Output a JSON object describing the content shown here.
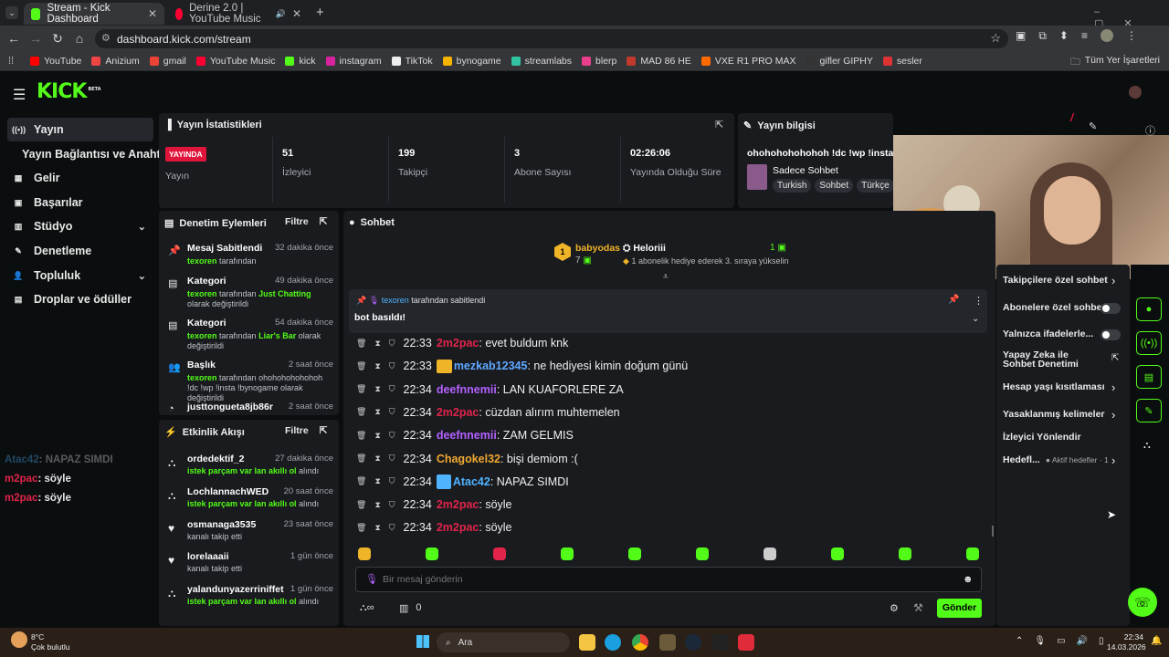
{
  "browser": {
    "tabs": [
      {
        "title": "Stream - Kick Dashboard",
        "favicon_color": "#53fc18"
      },
      {
        "title": "Derine 2.0 | YouTube Music",
        "favicon_color": "#ff0033"
      }
    ],
    "url": "dashboard.kick.com/stream",
    "bookmarks": [
      {
        "label": "YouTube",
        "color": "#ff0000"
      },
      {
        "label": "Anizium",
        "color": "#e44"
      },
      {
        "label": "gmail",
        "color": "#ea4335"
      },
      {
        "label": "YouTube Music",
        "color": "#ff0033"
      },
      {
        "label": "kick",
        "color": "#53fc18"
      },
      {
        "label": "instagram",
        "color": "#d6249f"
      },
      {
        "label": "TikTok",
        "color": "#eee"
      },
      {
        "label": "bynogame",
        "color": "#f4b400"
      },
      {
        "label": "streamlabs",
        "color": "#31c3a2"
      },
      {
        "label": "blerp",
        "color": "#e83e8c"
      },
      {
        "label": "MAD 86 HE",
        "color": "#c0392b"
      },
      {
        "label": "VXE R1 PRO MAX",
        "color": "#ff6a00"
      },
      {
        "label": "gifler GIPHY",
        "color": "#333"
      },
      {
        "label": "sesler",
        "color": "#d33"
      }
    ],
    "all_bookmarks": "Tüm Yer İşaretleri"
  },
  "kick": {
    "logo": "KICK",
    "logo_badge": "BETA",
    "sidebar": [
      {
        "label": "Yayın",
        "icon": "broadcast-icon",
        "glyph": "((•))",
        "active": true
      },
      {
        "label": "Yayın Bağlantısı ve Anahtarı",
        "icon": "",
        "glyph": ""
      },
      {
        "label": "Gelir",
        "icon": "revenue-icon",
        "glyph": "▦"
      },
      {
        "label": "Başarılar",
        "icon": "achievements-icon",
        "glyph": "▣"
      },
      {
        "label": "Stüdyo",
        "icon": "studio-icon",
        "glyph": "▥",
        "chevron": true
      },
      {
        "label": "Denetleme",
        "icon": "wrench-icon",
        "glyph": "✎"
      },
      {
        "label": "Topluluk",
        "icon": "community-icon",
        "glyph": "👤",
        "chevron": true
      },
      {
        "label": "Droplar ve ödüller",
        "icon": "drops-icon",
        "glyph": "▤"
      }
    ],
    "overlay_chat": [
      {
        "user": "Atac42",
        "text": ": NAPAZ SIMDI",
        "faded": true
      },
      {
        "user": "m2pac",
        "text": ": söyle"
      },
      {
        "user": "m2pac",
        "text": ": söyle"
      }
    ],
    "stats": {
      "title": "Yayın İstatistikleri",
      "live_badge": "YAYINDA",
      "live_label": "Yayın",
      "items": [
        {
          "value": "51",
          "label": "İzleyici"
        },
        {
          "value": "199",
          "label": "Takipçi"
        },
        {
          "value": "3",
          "label": "Abone Sayısı"
        },
        {
          "value": "02:26:06",
          "label": "Yayında Olduğu Süre"
        }
      ]
    },
    "stream_info": {
      "title": "Yayın bilgisi",
      "stream_title": "ohohohohohohoh !dc !wp !insta !by",
      "category": "Sadece Sohbet",
      "tags": [
        "Turkish",
        "Sohbet",
        "Türkçe"
      ]
    },
    "mod_actions": {
      "title": "Denetim Eylemleri",
      "filter": "Filtre",
      "items": [
        {
          "title": "Mesaj Sabitlendi",
          "time": "32 dakika önce",
          "user": "texoren",
          "sub": "tarafından",
          "icon": "pin-icon",
          "glyph": "📌"
        },
        {
          "title": "Kategori",
          "time": "49 dakika önce",
          "user": "texoren",
          "sub": "tarafından",
          "hl": "Just Chatting",
          "sub2": "olarak değiştirildi",
          "icon": "category-icon",
          "glyph": "▤"
        },
        {
          "title": "Kategori",
          "time": "54 dakika önce",
          "user": "texoren",
          "sub": "tarafından",
          "hl": "Liar's Bar",
          "sub2": "olarak değiştirildi",
          "icon": "category-icon",
          "glyph": "▤"
        },
        {
          "title": "Başlık",
          "time": "2 saat önce",
          "user": "texoren",
          "sub": "tarafından",
          "hl": "",
          "sub2": "ohohohohohohoh !dc !wp !insta !bynogame olarak değiştirildi",
          "icon": "title-icon",
          "glyph": "👥"
        },
        {
          "title": "justtongueta8jb86r",
          "time": "2 saat önce",
          "icon": "gauge-icon",
          "glyph": "◔"
        }
      ]
    },
    "activity": {
      "title": "Etkinlik Akışı",
      "filter": "Filtre",
      "items": [
        {
          "user": "ordedektif_2",
          "time": "27 dakika önce",
          "hl": "istek parçam var lan akıllı ol",
          "sub": "alındı",
          "icon": "redeem-icon"
        },
        {
          "user": "LochlannachWED",
          "time": "20 saat önce",
          "hl": "istek parçam var lan akıllı ol",
          "sub": "alındı",
          "icon": "redeem-icon"
        },
        {
          "user": "osmanaga3535",
          "time": "23 saat önce",
          "hl": "",
          "sub": "kanalı takip etti",
          "icon": "heart-icon"
        },
        {
          "user": "lorelaaaii",
          "time": "1 gün önce",
          "hl": "",
          "sub": "kanalı takip etti",
          "icon": "heart-icon"
        },
        {
          "user": "yalandunyazerriniffet",
          "time": "1 gün önce",
          "hl": "istek parçam var lan akıllı ol",
          "sub": "alındı",
          "icon": "redeem-icon"
        }
      ]
    },
    "chat": {
      "title": "Sohbet",
      "gift_user": "babyodas",
      "gift_count": "7",
      "gift_target": "Heloriii",
      "gift_rank": "1",
      "gift_text": "1 abonelik hediye ederek 3. sıraya yükselin",
      "pinned_by": "texoren",
      "pinned_suffix": "tarafından sabitlendi",
      "pinned_text": "bot basıldı!",
      "messages": [
        {
          "time": "22:33",
          "user": "2m2pac",
          "color": "#e0244a",
          "text": ": evet buldum knk",
          "badge": ""
        },
        {
          "time": "22:33",
          "user": "mezkab12345",
          "color": "#5fa8ff",
          "text": ": ne hediyesi kimin doğum günü",
          "badge": "crown"
        },
        {
          "time": "22:34",
          "user": "deefnnemii",
          "color": "#b461ff",
          "text": ": LAN KUAFORLERE ZA",
          "badge": ""
        },
        {
          "time": "22:34",
          "user": "2m2pac",
          "color": "#e0244a",
          "text": ": cüzdan alırım muhtemelen",
          "badge": ""
        },
        {
          "time": "22:34",
          "user": "deefnnemii",
          "color": "#b461ff",
          "text": ": ZAM GELMIS",
          "badge": ""
        },
        {
          "time": "22:34",
          "user": "Chagokel32",
          "color": "#f0a830",
          "text": ": bişi demiom :(",
          "badge": ""
        },
        {
          "time": "22:34",
          "user": "Atac42",
          "color": "#4fb3ff",
          "text": ": NAPAZ SIMDI",
          "badge": "avatar"
        },
        {
          "time": "22:34",
          "user": "2m2pac",
          "color": "#e0244a",
          "text": ": söyle",
          "badge": ""
        },
        {
          "time": "22:34",
          "user": "2m2pac",
          "color": "#e0244a",
          "text": ": söyle",
          "badge": ""
        }
      ],
      "input_placeholder": "Bir mesaj gönderin",
      "points": "0",
      "send": "Gönder"
    },
    "chat_settings": [
      {
        "label": "Takipçilere özel sohbet",
        "kind": "arrow"
      },
      {
        "label": "Abonelere özel sohbet",
        "kind": "toggle"
      },
      {
        "label": "Yalnızca ifadelerle...",
        "kind": "toggle"
      },
      {
        "label": "Yapay Zeka ile Sohbet Denetimi",
        "kind": "external"
      },
      {
        "label": "Hesap yaşı kısıtlaması",
        "kind": "arrow"
      },
      {
        "label": "Yasaklanmış kelimeler",
        "kind": "arrow"
      },
      {
        "label": "İzleyici Yönlendir",
        "kind": "none"
      },
      {
        "label": "Hedefl...",
        "kind": "arrow",
        "extra": "Aktif hedefler · 1"
      }
    ]
  },
  "taskbar": {
    "weather_temp": "8°C",
    "weather_text": "Çok bulutlu",
    "search": "Ara",
    "time": "22:34",
    "date": "14.03.2026"
  },
  "colors": {
    "accent": "#53fc18",
    "panel": "#191b1f",
    "bg": "#0b0e0f"
  }
}
